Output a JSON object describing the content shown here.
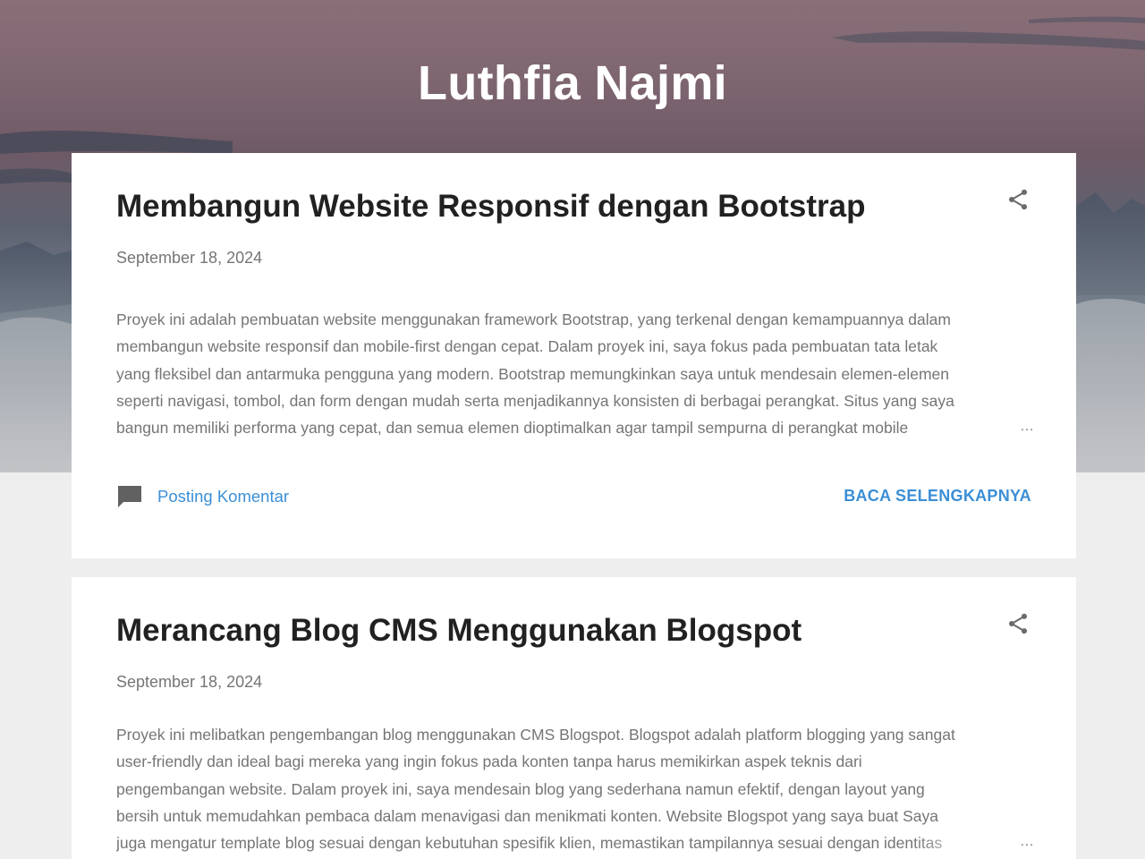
{
  "header": {
    "blog_title": "Luthfia Najmi"
  },
  "posts": [
    {
      "title": "Membangun Website Responsif dengan Bootstrap",
      "date": "September 18, 2024",
      "snippet_lines": [
        "Proyek ini adalah pembuatan website menggunakan framework Bootstrap, yang terkenal dengan kemampuannya dalam",
        "membangun website responsif dan mobile-first dengan cepat. Dalam proyek ini, saya fokus pada pembuatan tata letak",
        "yang fleksibel dan antarmuka pengguna yang modern. Bootstrap memungkinkan saya untuk mendesain elemen-elemen",
        "seperti navigasi, tombol, dan form dengan mudah serta menjadikannya konsisten di berbagai perangkat. Situs yang saya",
        "bangun memiliki performa yang cepat, dan semua elemen dioptimalkan agar tampil sempurna di perangkat mobile"
      ],
      "ellipsis": "…",
      "comment_label": "Posting Komentar",
      "read_more_label": "BACA SELENGKAPNYA"
    },
    {
      "title": "Merancang Blog CMS Menggunakan Blogspot",
      "date": "September 18, 2024",
      "snippet_lines": [
        "Proyek ini melibatkan pengembangan blog menggunakan CMS Blogspot. Blogspot adalah platform blogging yang sangat",
        "user-friendly dan ideal bagi mereka yang ingin fokus pada konten tanpa harus memikirkan aspek teknis dari",
        "pengembangan website. Dalam proyek ini, saya mendesain blog yang sederhana namun efektif, dengan layout yang",
        "bersih untuk memudahkan pembaca dalam menavigasi dan menikmati konten. Website Blogspot yang saya buat Saya",
        "juga mengatur template blog sesuai dengan kebutuhan spesifik klien, memastikan tampilannya sesuai dengan identitas"
      ],
      "ellipsis": "…"
    }
  ],
  "icons": {
    "share": "share-icon",
    "comment": "comment-icon"
  },
  "colors": {
    "link": "#3b8fd6",
    "title_text": "#212121",
    "meta_text": "#757575",
    "page_background": "#eeeeee"
  }
}
